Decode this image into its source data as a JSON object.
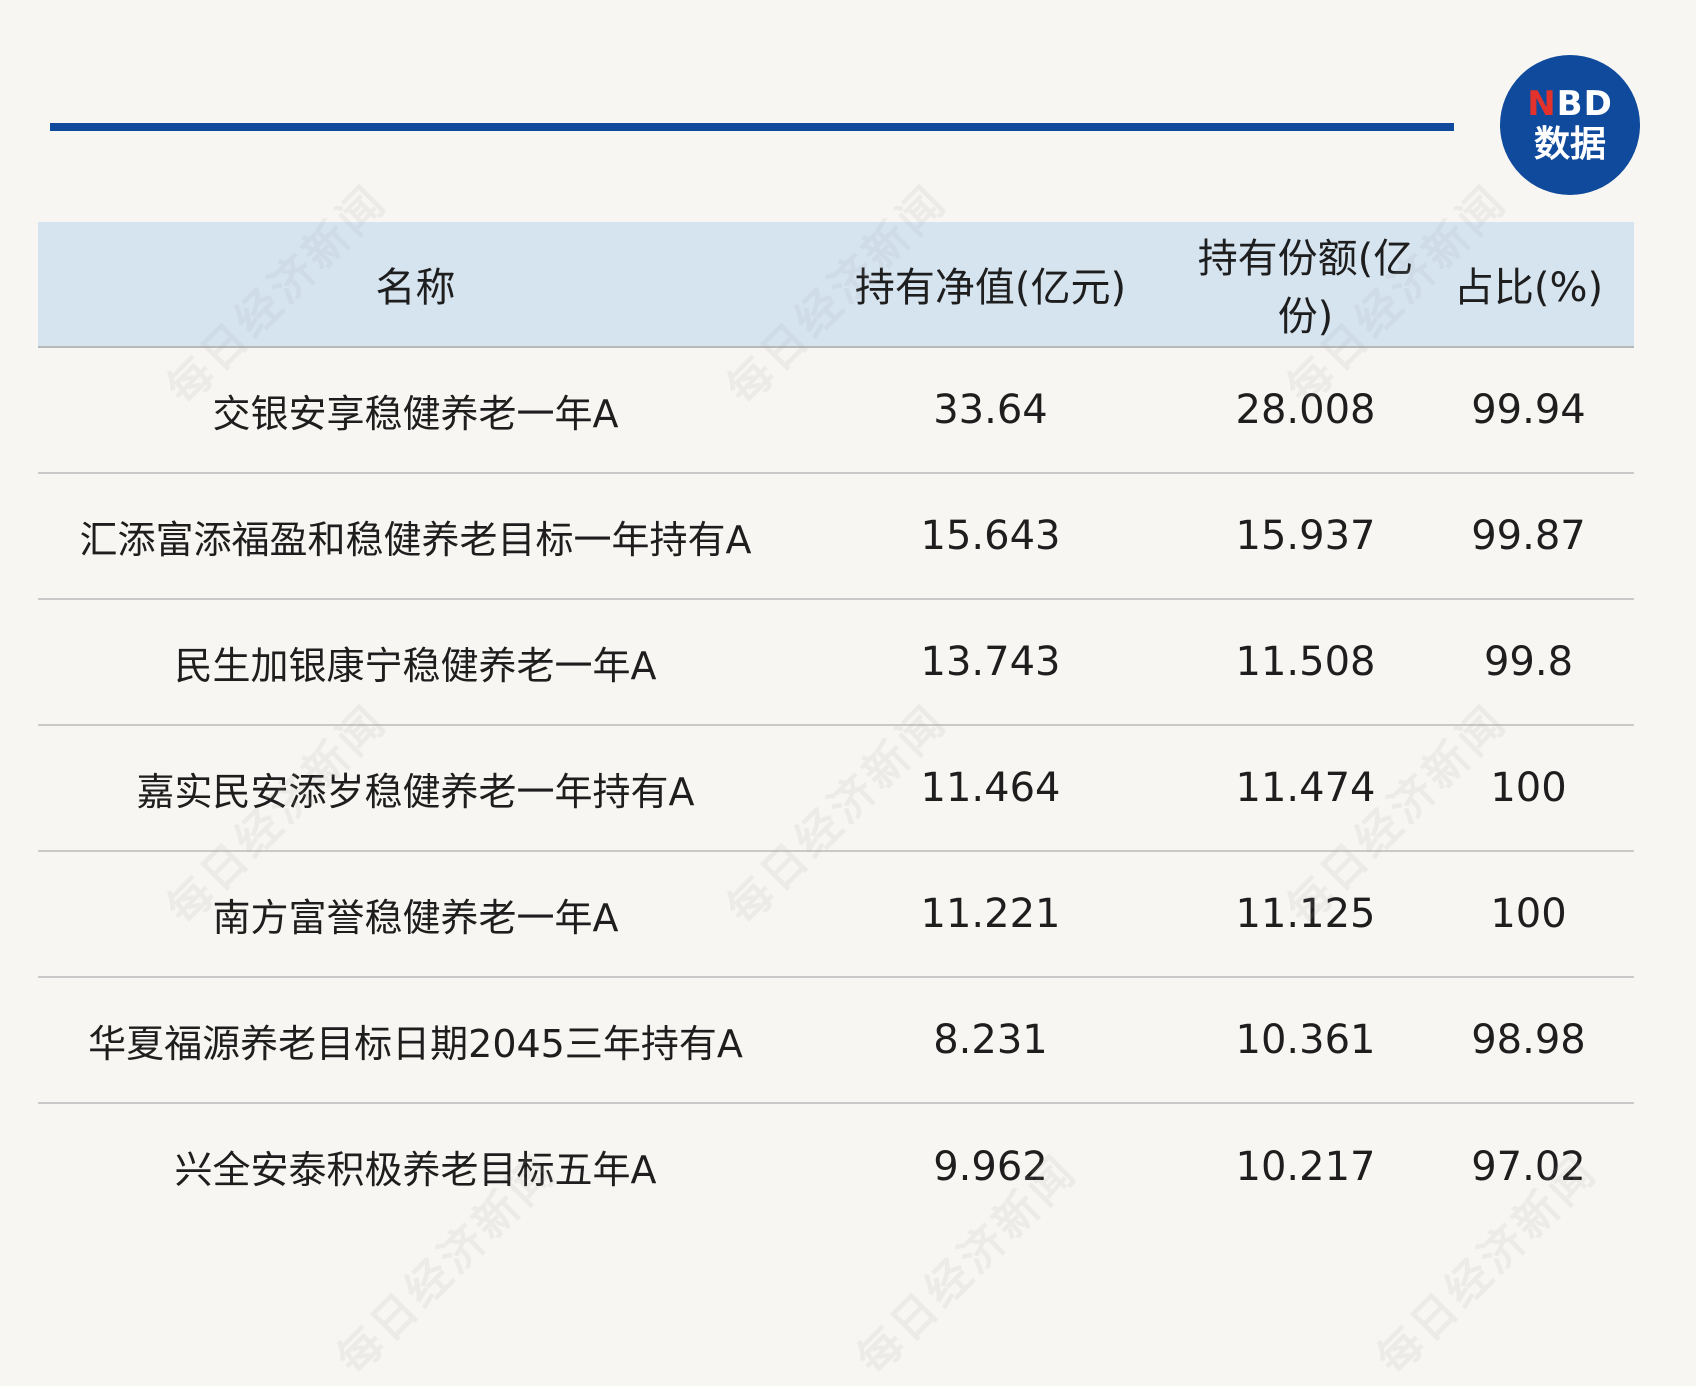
{
  "logo": {
    "brand_n": "N",
    "brand_rest": "BD",
    "subtitle": "数据"
  },
  "watermark": {
    "text": "每日经济新闻"
  },
  "colors": {
    "accent": "#0f4a9c",
    "header_bg": "#d6e4f0",
    "logo_red": "#e3322b",
    "page_bg": "#f8f6f2"
  },
  "table": {
    "headers": [
      "名称",
      "持有净值(亿元)",
      "持有份额(亿份)",
      "占比(%)"
    ],
    "rows": [
      [
        "交银安享稳健养老一年A",
        "33.64",
        "28.008",
        "99.94"
      ],
      [
        "汇添富添福盈和稳健养老目标一年持有A",
        "15.643",
        "15.937",
        "99.87"
      ],
      [
        "民生加银康宁稳健养老一年A",
        "13.743",
        "11.508",
        "99.8"
      ],
      [
        "嘉实民安添岁稳健养老一年持有A",
        "11.464",
        "11.474",
        "100"
      ],
      [
        "南方富誉稳健养老一年A",
        "11.221",
        "11.125",
        "100"
      ],
      [
        "华夏福源养老目标日期2045三年持有A",
        "8.231",
        "10.361",
        "98.98"
      ],
      [
        "兴全安泰积极养老目标五年A",
        "9.962",
        "10.217",
        "97.02"
      ]
    ]
  }
}
